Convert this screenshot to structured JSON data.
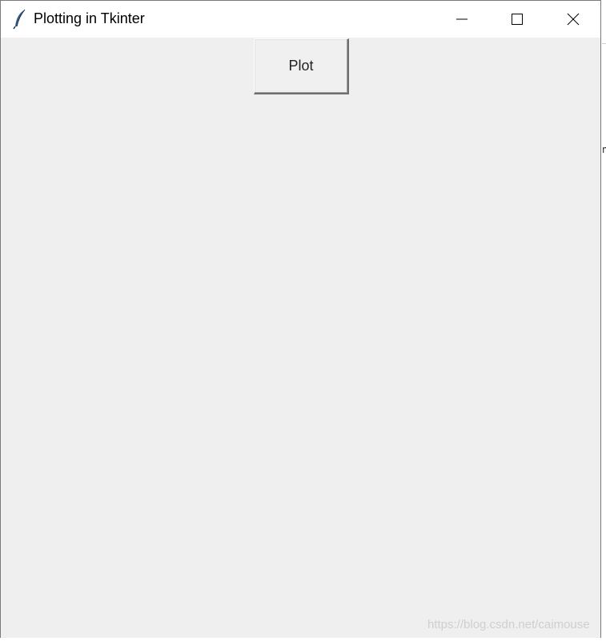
{
  "window": {
    "title": "Plotting in Tkinter",
    "app_icon": "feather-icon",
    "controls": {
      "minimize_icon": "minimize-icon",
      "maximize_icon": "maximize-icon",
      "close_icon": "close-icon"
    }
  },
  "main": {
    "plot_button_label": "Plot"
  },
  "watermark": "https://blog.csdn.net/caimouse",
  "background_window": {
    "partial_char": "n"
  },
  "colors": {
    "titlebar": "#ffffff",
    "client_background": "#efefef",
    "button_face": "#f0f0f0"
  }
}
